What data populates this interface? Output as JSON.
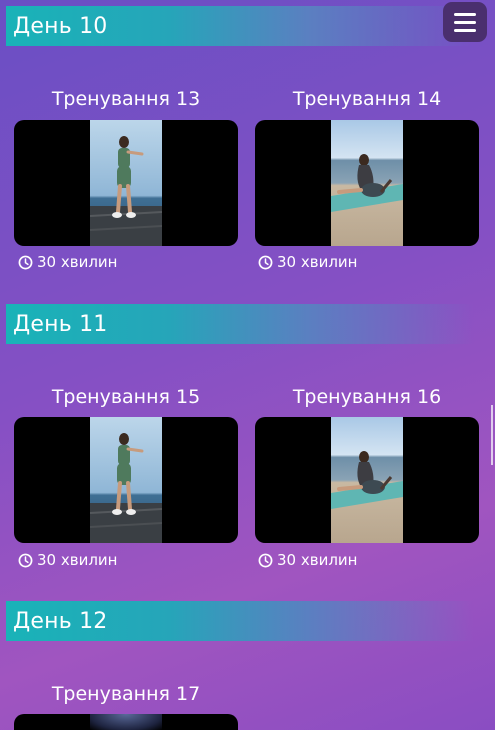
{
  "menu": {
    "icon": "hamburger-menu-icon"
  },
  "days": [
    {
      "title": "День 10",
      "workouts": [
        {
          "title": "Тренування 13",
          "duration": "30 хвилин",
          "scene": "standing"
        },
        {
          "title": "Тренування 14",
          "duration": "30 хвилин",
          "scene": "sitting"
        }
      ]
    },
    {
      "title": "День 11",
      "workouts": [
        {
          "title": "Тренування 15",
          "duration": "30 хвилин",
          "scene": "standing"
        },
        {
          "title": "Тренування 16",
          "duration": "30 хвилин",
          "scene": "sitting"
        }
      ]
    },
    {
      "title": "День 12",
      "workouts": [
        {
          "title": "Тренування 17",
          "duration": "",
          "scene": "dark"
        }
      ]
    }
  ],
  "icons": {
    "duration": "clock-icon"
  }
}
